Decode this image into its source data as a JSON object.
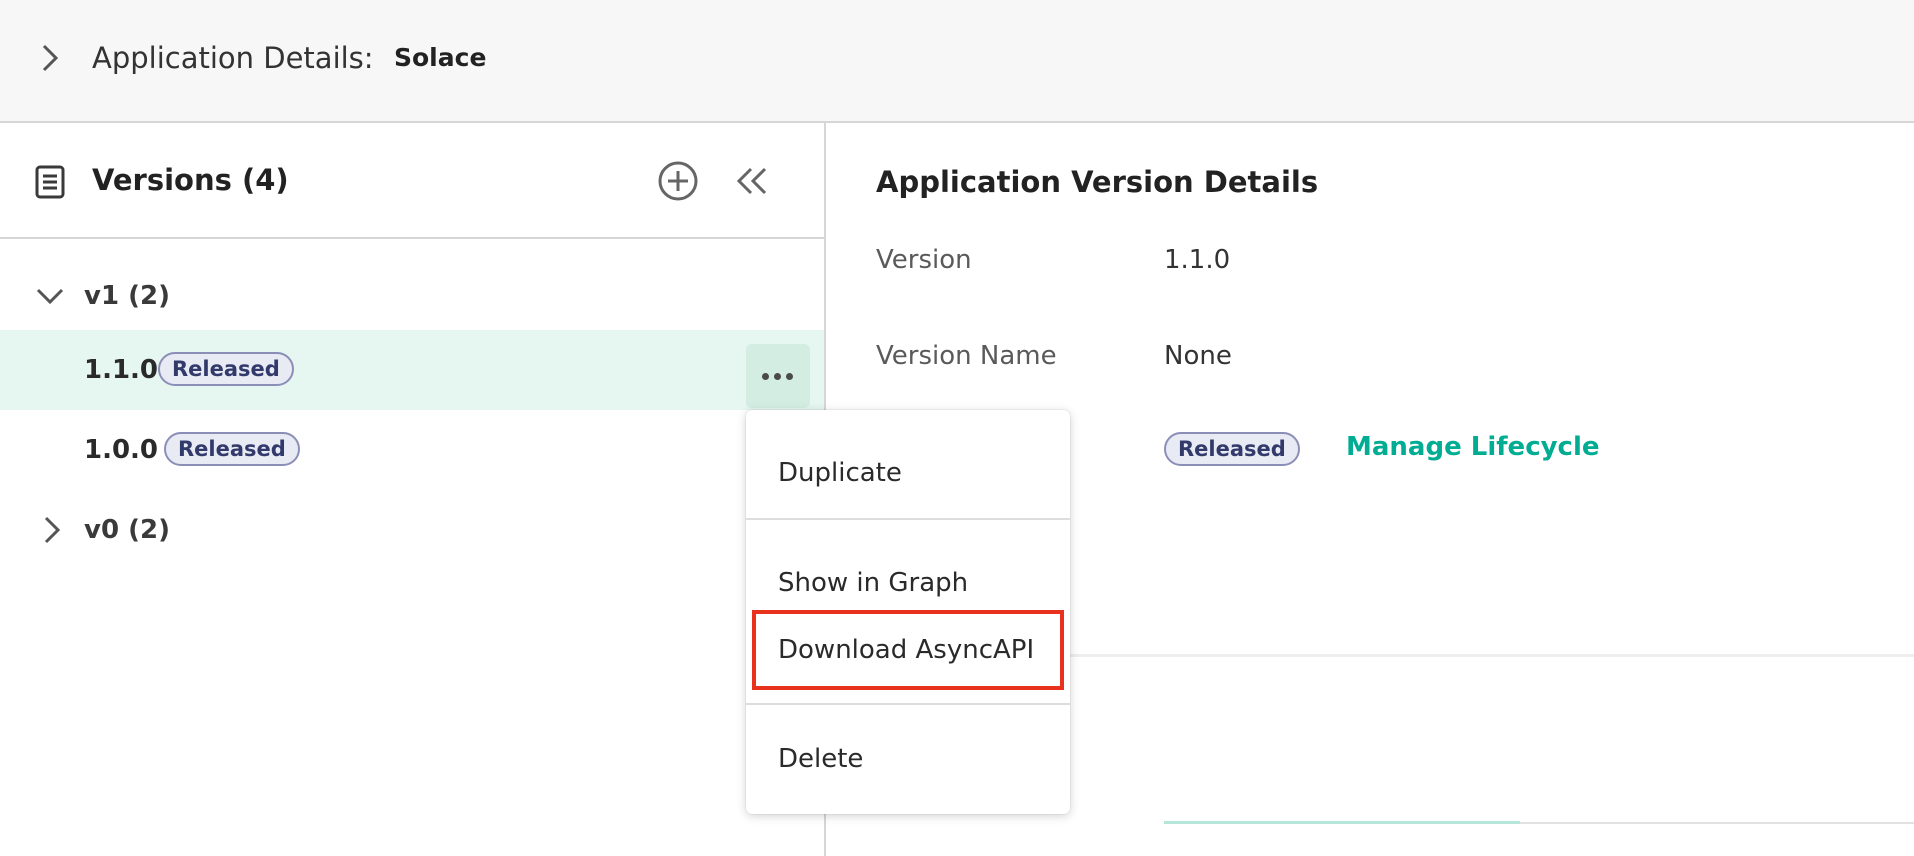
{
  "header": {
    "title": "Application Details:",
    "app_name": "Solace",
    "expand_icon": "chevron-right-icon"
  },
  "versions_panel": {
    "title": "Versions (4)",
    "list_icon": "list-document-icon",
    "add_icon": "plus-circle-icon",
    "collapse_icon": "double-chevron-left-icon",
    "groups": [
      {
        "label": "v1 (2)",
        "expanded": true,
        "versions": [
          {
            "number": "1.1.0",
            "status": "Released",
            "selected": true
          },
          {
            "number": "1.0.0",
            "status": "Released",
            "selected": false
          }
        ]
      },
      {
        "label": "v0 (2)",
        "expanded": false,
        "versions": []
      }
    ],
    "more_icon": "more-horizontal-icon"
  },
  "context_menu": {
    "items": [
      "Duplicate",
      "Show in Graph",
      "Download AsyncAPI",
      "Delete"
    ],
    "highlighted": "Download AsyncAPI"
  },
  "details": {
    "title": "Application Version Details",
    "version_label": "Version",
    "version_value": "1.1.0",
    "version_name_label": "Version Name",
    "version_name_value": "None",
    "state_value": "Released",
    "manage_lifecycle": "Manage Lifecycle"
  },
  "colors": {
    "accent": "#00ad93",
    "selected_row": "#e6f6f0",
    "badge_bg": "#e8eaf4",
    "badge_border": "#8b8fb8",
    "highlight": "#e8321e"
  }
}
